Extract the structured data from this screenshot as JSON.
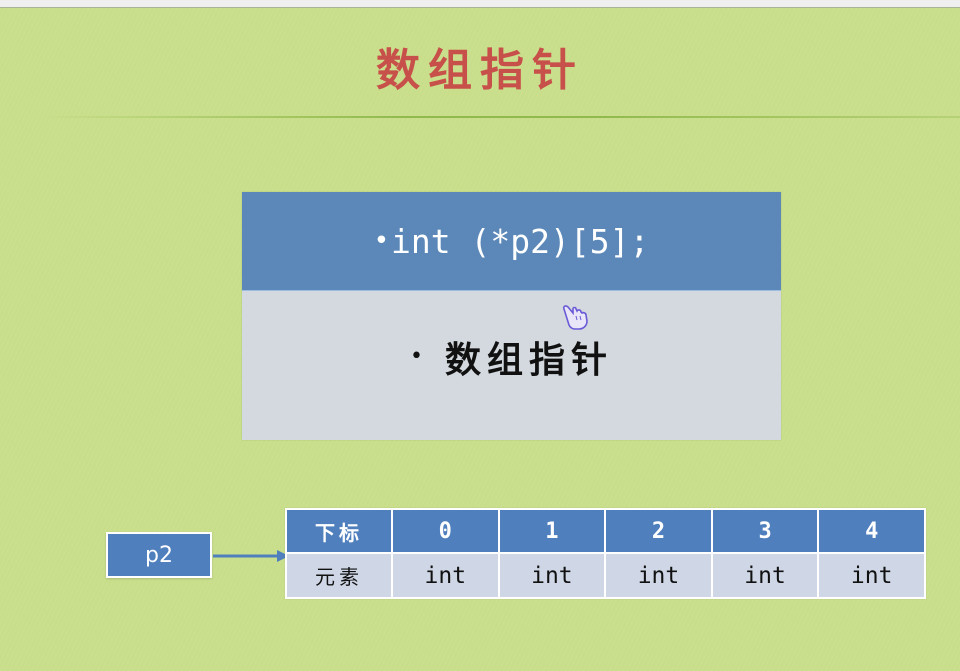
{
  "slide": {
    "title": "数组指针",
    "colors": {
      "background": "#c8de8a",
      "title": "#c8504a",
      "header_blue": "#5b88b8",
      "table_blue": "#4f7fbd",
      "body_gray": "#d3d9de",
      "cell_light": "#cfd7e6"
    }
  },
  "code_card": {
    "bullet": "•",
    "code": "int (*p2)[5];",
    "body_bullet": "•",
    "body_text": "数组指针"
  },
  "cursor": {
    "icon": "hand-pointer-icon"
  },
  "diagram": {
    "pointer_label": "p2",
    "arrow_icon": "right-arrow-icon",
    "table": {
      "index_label": "下标",
      "element_label": "元素",
      "indices": [
        "0",
        "1",
        "2",
        "3",
        "4"
      ],
      "elements": [
        "int",
        "int",
        "int",
        "int",
        "int"
      ]
    }
  }
}
